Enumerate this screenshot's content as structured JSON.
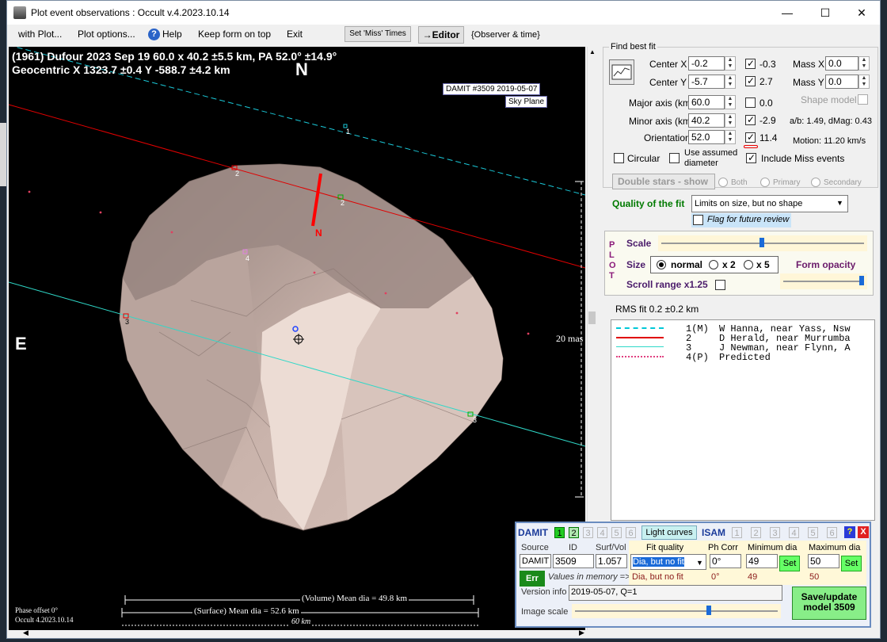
{
  "window": {
    "title": "Plot event observations : Occult v.4.2023.10.14"
  },
  "menu": {
    "with_plot": "with Plot...",
    "plot_options": "Plot options...",
    "help": "Help",
    "keep_on_top": "Keep form on top",
    "exit": "Exit",
    "set_miss": "Set 'Miss' Times",
    "editor": "→Editor",
    "observer_time": "{Observer & time}"
  },
  "plot": {
    "header_line1": "(1961) Dufour  2023 Sep 19   60.0 x 40.2 ±5.5 km,  PA 52.0° ±14.9°",
    "header_line2": "Geocentric  X  1323.7 ±0.4  Y  -588.7 ±4.2 km",
    "north": "N",
    "east": "E",
    "damit_label": "DAMIT #3509 2019-05-07",
    "sky_plane": "Sky Plane",
    "pole_label": "N",
    "scale_label": "20 mas",
    "chord_labels": [
      "1",
      "2",
      "2",
      "3",
      "3",
      "4"
    ],
    "phase_offset": "Phase offset 0°",
    "version": "Occult 4.2023.10.14",
    "volume_dia": "(Volume) Mean dia = 49.8 km",
    "surface_dia": "(Surface) Mean dia = 52.6 km",
    "km_scale": "60 km"
  },
  "fit": {
    "section_title": "Find best fit",
    "center_x_label": "Center X",
    "center_x": "-0.2",
    "center_y_label": "Center Y",
    "center_y": "-5.7",
    "major_label": "Major axis (km)",
    "major": "60.0",
    "minor_label": "Minor axis (km)",
    "minor": "40.2",
    "orient_label": "Orientation",
    "orient": "52.0",
    "chk_values": [
      "-0.3",
      "2.7",
      "0.0",
      "-2.9",
      "11.4"
    ],
    "mass_x_label": "Mass X",
    "mass_x": "0.0",
    "mass_y_label": "Mass Y",
    "mass_y": "0.0",
    "shape_model": "Shape model",
    "ab_text": "a/b: 1.49, dMag: 0.43",
    "motion_text": "Motion: 11.20 km/s",
    "circular": "Circular",
    "use_assumed": "Use assumed",
    "diameter": "diameter",
    "include_miss": "Include Miss events",
    "double_stars": "Double stars - show",
    "both": "Both",
    "primary": "Primary",
    "secondary": "Secondary",
    "quality_label": "Quality of the fit",
    "quality_value": "Limits on size, but no shape",
    "flag_review": "Flag for future review"
  },
  "plotctl": {
    "plot_vertical": [
      "P",
      "L",
      "O",
      "T"
    ],
    "scale": "Scale",
    "size": "Size",
    "normal": "normal",
    "x2": "x 2",
    "x5": "x 5",
    "form_opacity": "Form opacity",
    "scroll_range": "Scroll range x1.25",
    "rms": "RMS fit 0.2 ±0.2 km"
  },
  "legend": {
    "rows": [
      {
        "num": "1(M)",
        "text": "W Hanna, near Yass, Nsw",
        "color": "#00c8d8",
        "style": "dashed"
      },
      {
        "num": "2",
        "text": "D Herald, near Murrumba",
        "color": "#e00000",
        "style": "solid"
      },
      {
        "num": "3",
        "text": "J Newman, near Flynn, A",
        "color": "#2fd8c8",
        "style": "solid"
      },
      {
        "num": "4(P)",
        "text": "Predicted",
        "color": "#e04080",
        "style": "dotted"
      }
    ]
  },
  "damit": {
    "title": "DAMIT",
    "numbers": [
      "1",
      "2",
      "3",
      "4",
      "5",
      "6"
    ],
    "light_curves": "Light curves",
    "isam": "ISAM",
    "isam_numbers": [
      "1",
      "2",
      "3",
      "4",
      "5",
      "6"
    ],
    "help": "?",
    "close": "X",
    "source_label": "Source",
    "id_label": "ID",
    "surfvol_label": "Surf/Vol",
    "source": "DAMIT",
    "id": "3509",
    "surfvol": "1.057",
    "fit_quality_label": "Fit quality",
    "ph_corr_label": "Ph Corr",
    "min_dia_label": "Minimum dia",
    "max_dia_label": "Maximum dia",
    "fit_quality": "Dia, but no fit",
    "ph_corr": "0°",
    "min_dia": "49",
    "max_dia": "50",
    "set": "Set",
    "err": "Err",
    "values_memory": "Values in memory =>",
    "mem_fit": "Dia, but no fit",
    "mem_ph": "0°",
    "mem_min": "49",
    "mem_max": "50",
    "version_label": "Version info",
    "version_value": "2019-05-07, Q=1",
    "image_scale": "Image scale",
    "save_button": "Save/update model 3509"
  }
}
